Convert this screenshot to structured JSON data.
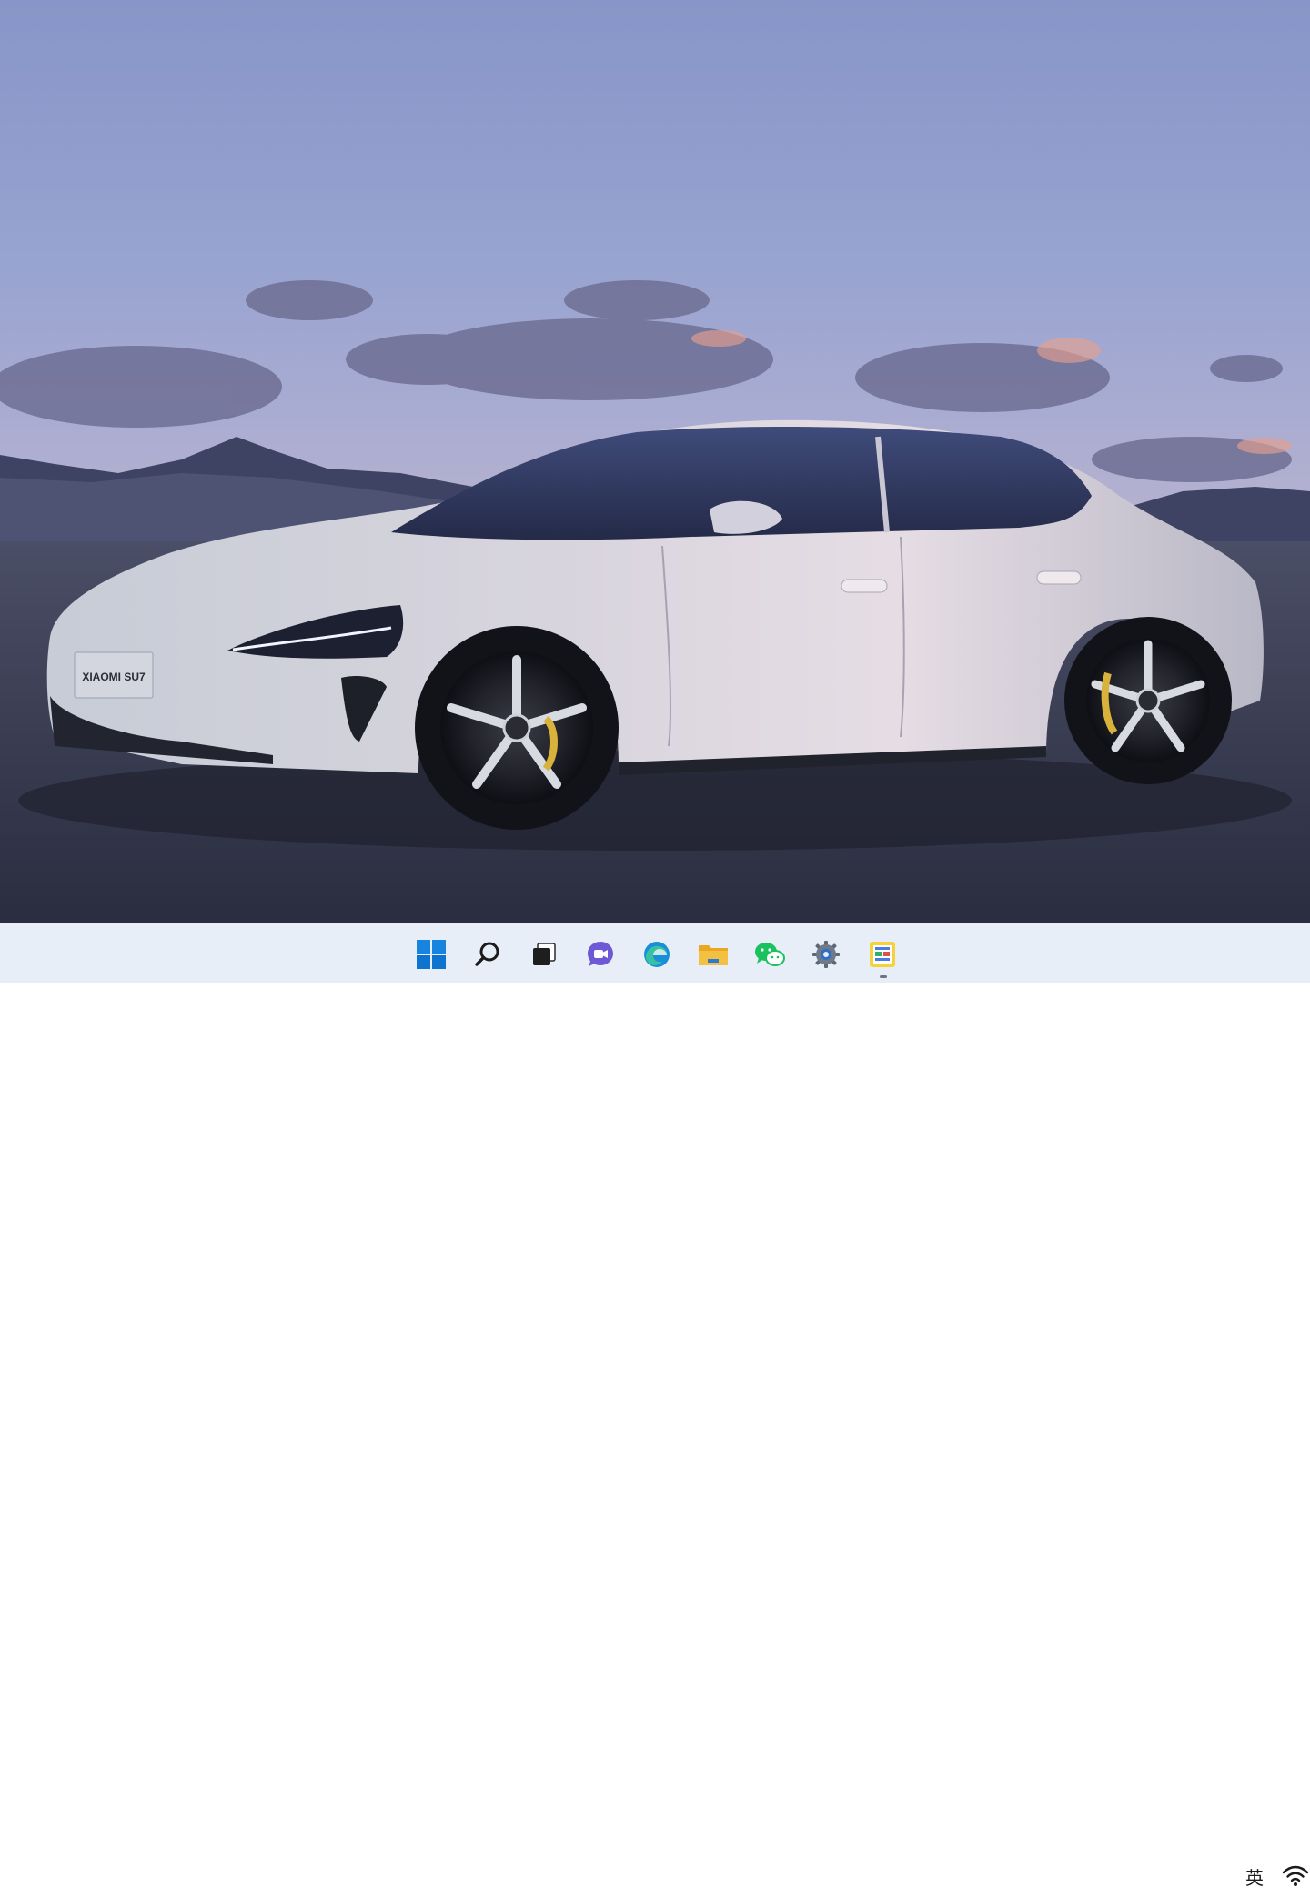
{
  "wallpaper": {
    "car_badge_text": "XIAOMI SU7"
  },
  "taskbar": {
    "items": [
      {
        "name": "start",
        "icon": "windows-logo-icon"
      },
      {
        "name": "search",
        "icon": "search-icon"
      },
      {
        "name": "task-view",
        "icon": "task-view-icon"
      },
      {
        "name": "teams-chat",
        "icon": "chat-camera-icon"
      },
      {
        "name": "edge",
        "icon": "edge-browser-icon"
      },
      {
        "name": "file-explorer",
        "icon": "folder-icon"
      },
      {
        "name": "wechat",
        "icon": "wechat-icon"
      },
      {
        "name": "settings",
        "icon": "gear-icon"
      },
      {
        "name": "image-viewer",
        "icon": "image-viewer-icon",
        "active": true
      }
    ],
    "tray": {
      "input_method": "英",
      "network_icon": "wifi-icon"
    },
    "colors": {
      "background": "#e8eef7",
      "windows_blue": "#0f7bd9",
      "chat_purple": "#6d58d6",
      "folder_yellow": "#f4c042",
      "wechat_green": "#19c25f"
    }
  }
}
